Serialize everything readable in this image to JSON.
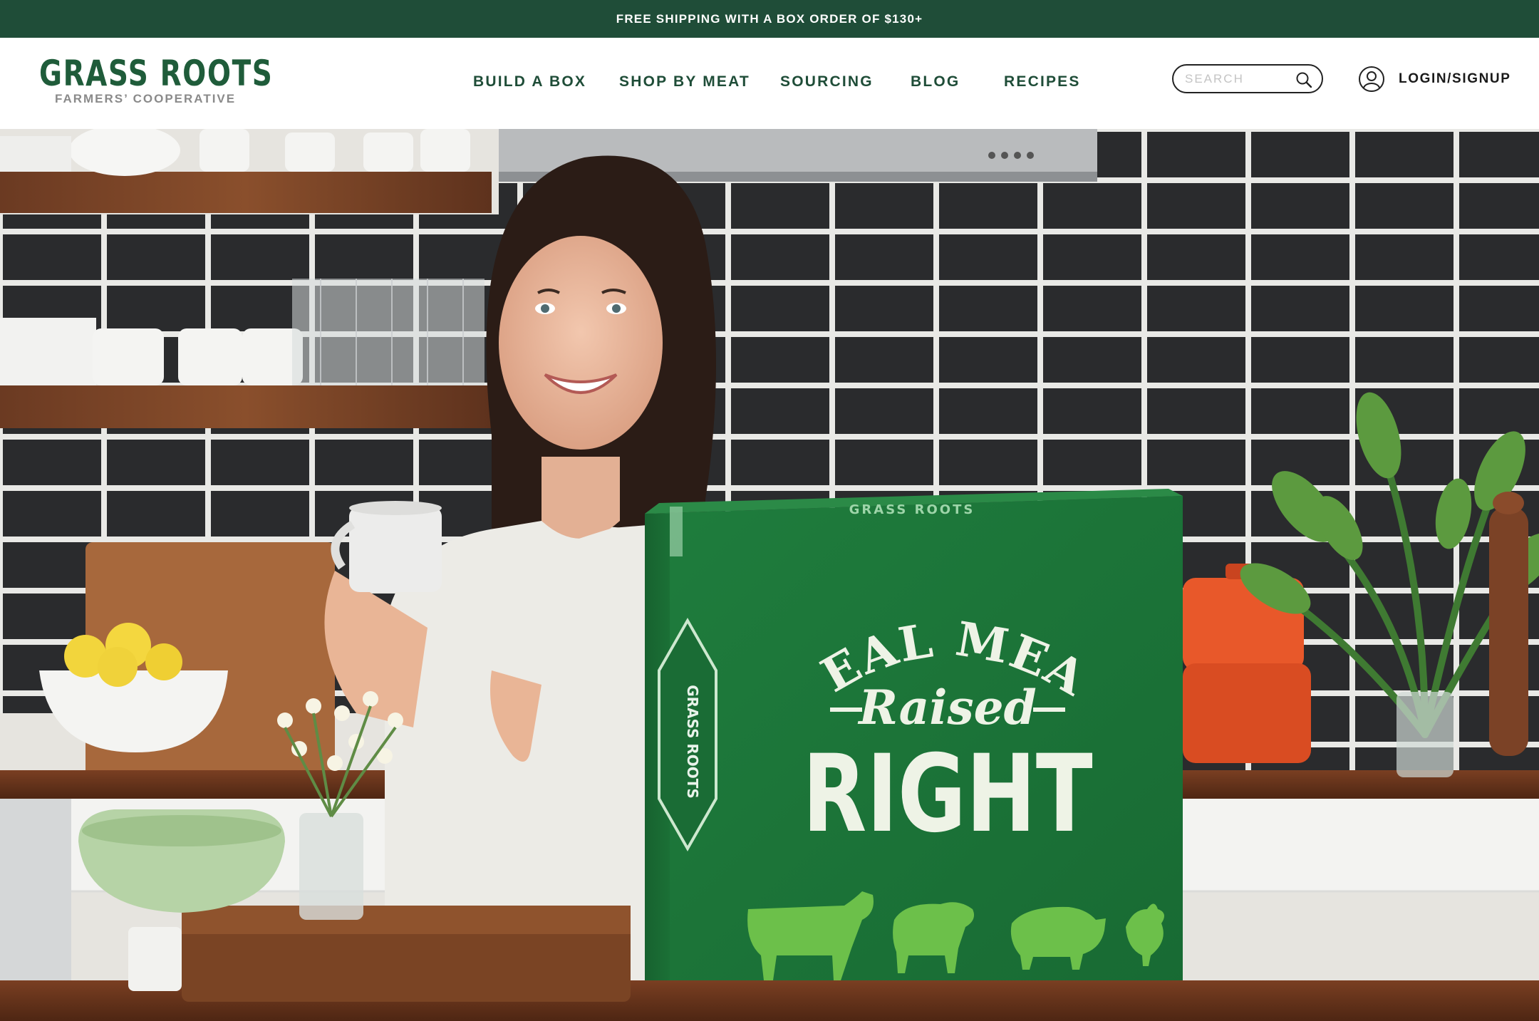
{
  "promo": {
    "text": "FREE SHIPPING WITH A BOX ORDER OF $130+"
  },
  "brand": {
    "name": "GRASS ROOTS",
    "tagline": "FARMERS’ COOPERATIVE"
  },
  "nav": {
    "items": [
      {
        "label": "BUILD A BOX"
      },
      {
        "label": "SHOP BY MEAT"
      },
      {
        "label": "SOURCING"
      },
      {
        "label": "BLOG"
      },
      {
        "label": "RECIPES"
      }
    ]
  },
  "search": {
    "placeholder": "SEARCH",
    "value": ""
  },
  "account": {
    "label": "LOGIN/SIGNUP",
    "icon": "user-icon"
  },
  "hero": {
    "box_text": {
      "line1": "REAL MEAT",
      "line2": "Raised",
      "line3": "RIGHT",
      "lid": "GRASS ROOTS",
      "badge": "GRASS ROOTS"
    },
    "box_animals": [
      "cow",
      "lamb",
      "pig",
      "chicken"
    ]
  },
  "colors": {
    "brand_green": "#1f4d38",
    "logo_green": "#1f5c3a",
    "box_green": "#1e7a3c",
    "animal_green": "#6cc04a"
  }
}
